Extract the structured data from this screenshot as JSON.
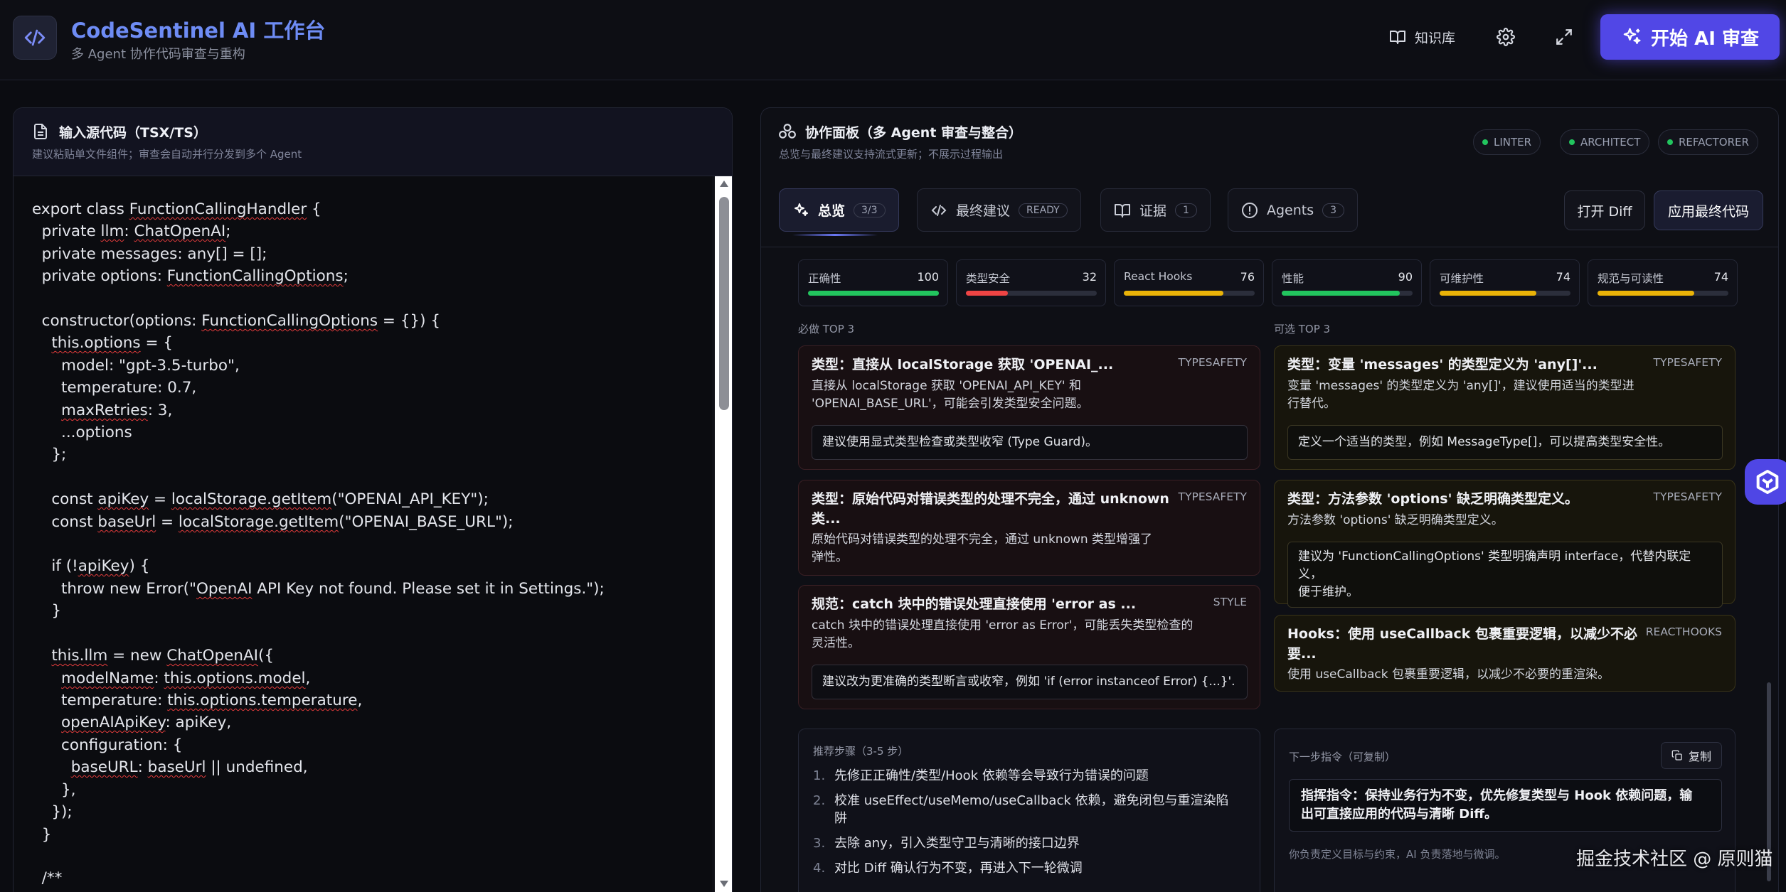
{
  "header": {
    "title": "CodeSentinel AI 工作台",
    "subtitle": "多 Agent 协作代码审查与重构",
    "knowledge_label": "知识库",
    "start_label": "开始 AI 审查"
  },
  "left": {
    "title": "输入源代码（TSX/TS）",
    "subtitle": "建议粘贴单文件组件；审查会自动并行分发到多个 Agent"
  },
  "right": {
    "title": "协作面板（多 Agent 审查与整合）",
    "subtitle": "总览与最终建议支持流式更新；不展示过程输出",
    "agents": [
      "LINTER",
      "ARCHITECT",
      "REFACTORER"
    ],
    "tabs": [
      {
        "label": "总览",
        "badge": "3/3"
      },
      {
        "label": "最终建议",
        "badge": "READY"
      },
      {
        "label": "证据",
        "badge": "1"
      },
      {
        "label": "Agents",
        "badge": "3"
      }
    ],
    "open_diff": "打开 Diff",
    "apply_code": "应用最终代码"
  },
  "metrics": [
    {
      "label": "正确性",
      "value": 100,
      "color": "#22c55e"
    },
    {
      "label": "类型安全",
      "value": 32,
      "color": "#ef4444"
    },
    {
      "label": "React Hooks",
      "value": 76,
      "color": "#eab308"
    },
    {
      "label": "性能",
      "value": 90,
      "color": "#22c55e"
    },
    {
      "label": "可维护性",
      "value": 74,
      "color": "#eab308"
    },
    {
      "label": "规范与可读性",
      "value": 74,
      "color": "#eab308"
    }
  ],
  "must": {
    "label": "必做 TOP 3",
    "cards": [
      {
        "title": "类型：直接从 localStorage 获取 'OPENAI_...",
        "tag": "TYPESAFETY",
        "desc1": "直接从 localStorage 获取 'OPENAI_API_KEY' 和",
        "desc2": "'OPENAI_BASE_URL'，可能会引发类型安全问题。",
        "box": "建议使用显式类型检查或类型收窄 (Type Guard)。"
      },
      {
        "title1": "类型：原始代码对错误类型的处理不完全，通过 unknown",
        "title2": "类...",
        "tag": "TYPESAFETY",
        "desc1": "原始代码对错误类型的处理不完全，通过 unknown 类型增强了",
        "desc2": "弹性。"
      },
      {
        "title": "规范：catch 块中的错误处理直接使用 'error as ...",
        "tag": "STYLE",
        "desc1": "catch 块中的错误处理直接使用 'error as Error'，可能丢失类型检查的",
        "desc2": "灵活性。",
        "box": "建议改为更准确的类型断言或收窄，例如 'if (error instanceof Error) {...}'."
      }
    ]
  },
  "optional": {
    "label": "可选 TOP 3",
    "cards": [
      {
        "title": "类型：变量 'messages' 的类型定义为 'any[]'...",
        "tag": "TYPESAFETY",
        "desc1": "变量 'messages' 的类型定义为 'any[]'，建议使用适当的类型进",
        "desc2": "行替代。",
        "box": "定义一个适当的类型，例如 MessageType[]，可以提高类型安全性。"
      },
      {
        "title": "类型：方法参数 'options' 缺乏明确类型定义。",
        "tag": "TYPESAFETY",
        "desc1": "方法参数 'options' 缺乏明确类型定义。",
        "box1": "建议为 'FunctionCallingOptions' 类型明确声明 interface，代替内联定义，",
        "box2": "便于维护。"
      },
      {
        "title1": "Hooks：使用 useCallback 包裹重要逻辑，以减少不必",
        "title2": "要...",
        "tag": "REACTHOOKS",
        "desc1": "使用 useCallback 包裹重要逻辑，以减少不必要的重渲染。"
      }
    ]
  },
  "steps": {
    "label": "推荐步骤（3-5 步）",
    "items": [
      {
        "num": "1.",
        "text": "先修正正确性/类型/Hook 依赖等会导致行为错误的问题"
      },
      {
        "num": "2.",
        "text1": "校准 useEffect/useMemo/useCallback 依赖，避免闭包与重渲染陷",
        "text2": "阱"
      },
      {
        "num": "3.",
        "text": "去除 any，引入类型守卫与清晰的接口边界"
      },
      {
        "num": "4.",
        "text": "对比 Diff 确认行为不变，再进入下一轮微调"
      }
    ]
  },
  "next": {
    "label": "下一步指令（可复制）",
    "copy_label": "复制",
    "cmd1": "指挥指令：保持业务行为不变，优先修复类型与 Hook 依赖问题，输",
    "cmd2": "出可直接应用的代码与清晰 Diff。",
    "hint": "你负责定义目标与约束，AI 负责落地与微调。"
  },
  "watermark": "掘金技术社区 @ 原则猫"
}
